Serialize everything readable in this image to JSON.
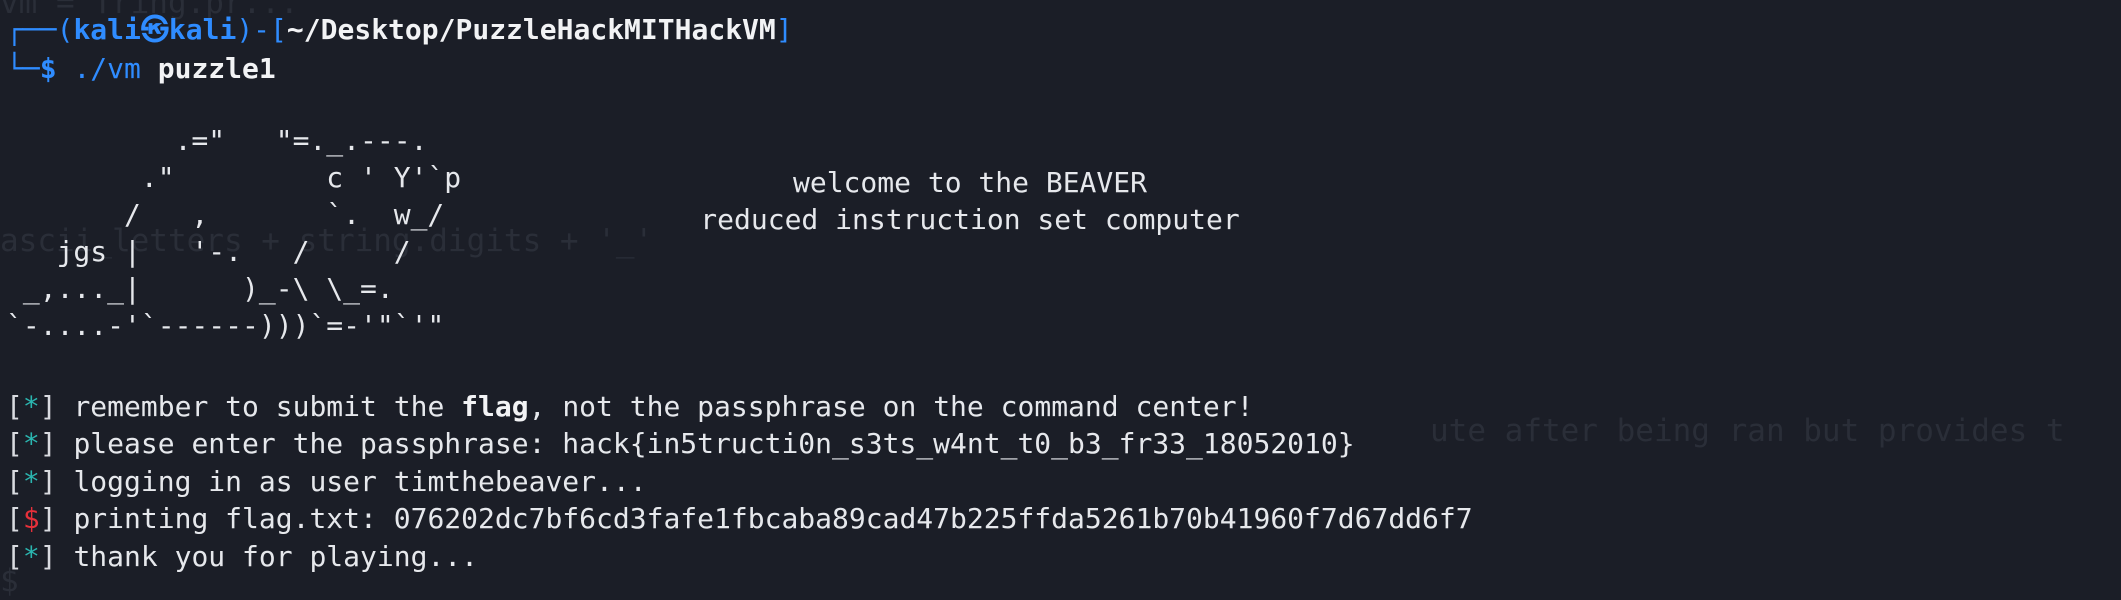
{
  "ghost": {
    "line_top": "vm = Tring.pr...",
    "line_mid": "ascii_letters + string.digits + '_'",
    "line_right": "ute after being ran but provides t",
    "line_bottom": "$"
  },
  "prompt": {
    "bracket_open": "┌──(",
    "user": "kali",
    "at_symbol": "㉿",
    "host": "kali",
    "sep": ")-[",
    "path": "~/Desktop/PuzzleHackMITHackVM",
    "bracket_close": "]",
    "corner": "└─",
    "dollar": "$",
    "command": "./vm",
    "argument": "puzzle1"
  },
  "ascii_art": "          .=\"   \"=._.---.\n        .\"         c ' Y'`p\n       /   ,       `.  w_/\n   jgs |   '-.   /     /\n _,..._|      )_-\\ \\_=.\n`-....-'`------)))`=-'\"`'\"",
  "banner": {
    "line1": "welcome to the BEAVER",
    "line2": "reduced instruction set computer"
  },
  "output": [
    {
      "marker": "*",
      "pre": "remember to submit the ",
      "bold": "flag",
      "post": ", not the passphrase on the command center!"
    },
    {
      "marker": "*",
      "pre": "please enter the passphrase: hack{in5tructi0n_s3ts_w4nt_t0_b3_fr33_18052010}",
      "bold": "",
      "post": ""
    },
    {
      "marker": "*",
      "pre": "logging in as user timthebeaver...",
      "bold": "",
      "post": ""
    },
    {
      "marker": "$",
      "pre": "printing flag.txt: 076202dc7bf6cd3fafe1fbcaba89cad47b225ffda5261b70b41960f7d67dd6f7",
      "bold": "",
      "post": ""
    },
    {
      "marker": "*",
      "pre": "thank you for playing...",
      "bold": "",
      "post": ""
    }
  ],
  "colors": {
    "background": "#1b1e27",
    "prompt_blue": "#2f8cff",
    "marker_teal": "#2bb6b0",
    "marker_red": "#e6303a"
  }
}
